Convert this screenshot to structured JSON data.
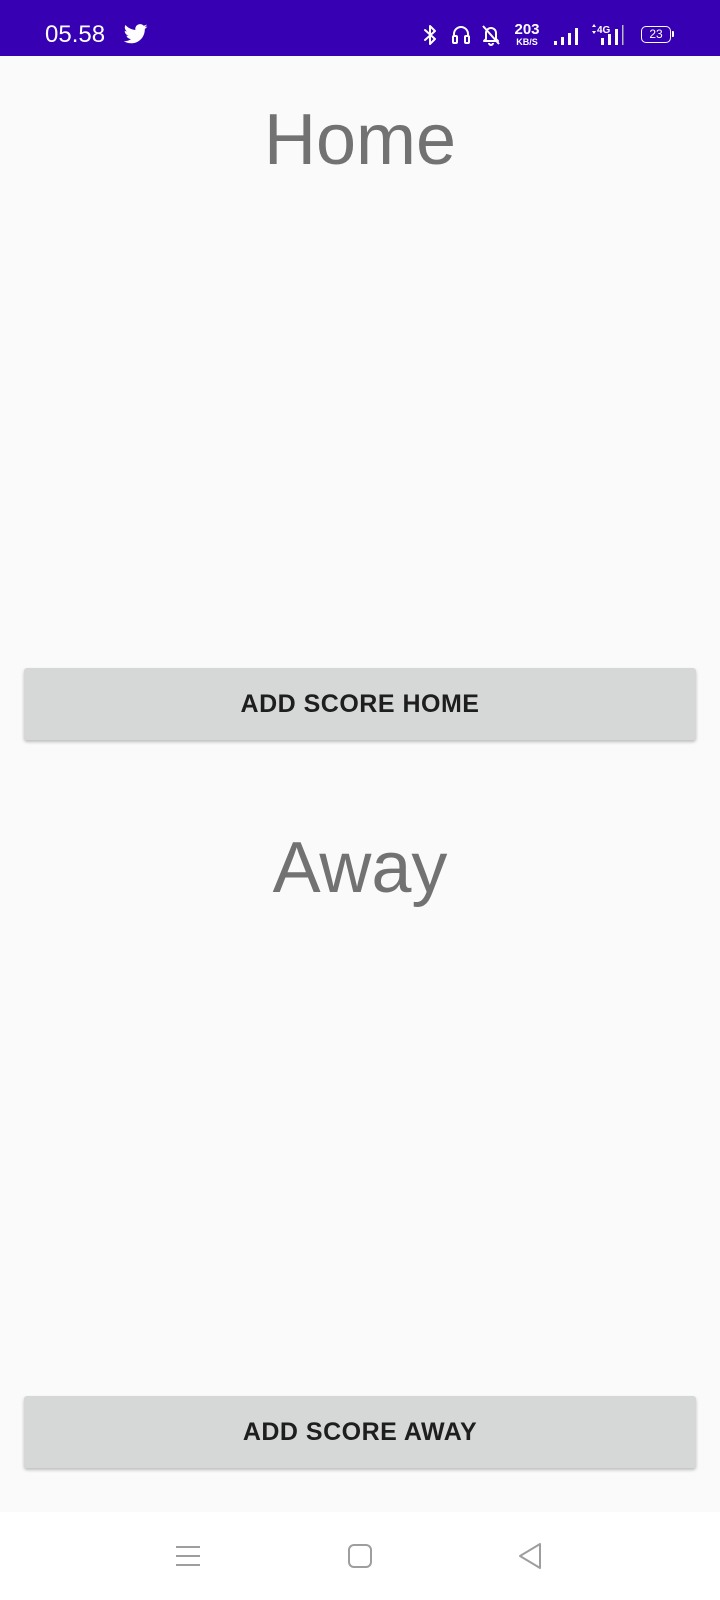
{
  "status_bar": {
    "time": "05.58",
    "speed_value": "203",
    "speed_unit": "KB/S",
    "network_type": "4G",
    "battery_level": "23",
    "background_color": "#3700b3",
    "icons": [
      "twitter-icon",
      "bluetooth-icon",
      "headphones-icon",
      "bell-off-icon",
      "signal-icon",
      "signal-4g-icon",
      "battery-icon"
    ]
  },
  "home": {
    "title": "Home",
    "button_label": "ADD SCORE HOME"
  },
  "away": {
    "title": "Away",
    "button_label": "ADD SCORE AWAY"
  },
  "colors": {
    "background": "#fafafa",
    "title_text": "#727272",
    "button_background": "#d6d7d7",
    "button_text": "#1e1e1e"
  },
  "nav_bar": {
    "icons": [
      "menu-icon",
      "home-square-icon",
      "back-triangle-icon"
    ]
  }
}
